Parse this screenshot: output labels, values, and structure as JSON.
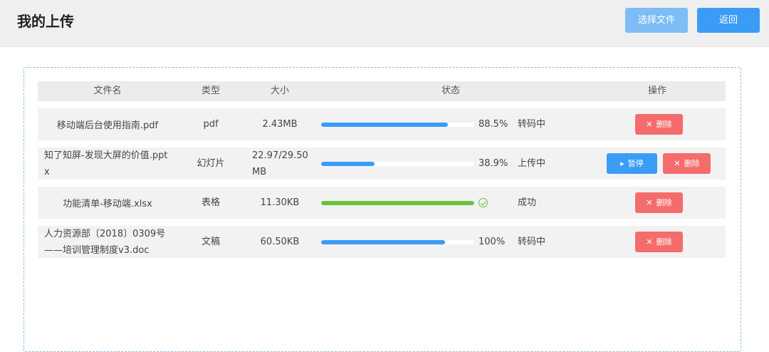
{
  "header": {
    "title": "我的上传",
    "select_label": "选择文件",
    "back_label": "返回"
  },
  "table": {
    "columns": [
      "文件名",
      "类型",
      "大小",
      "状态",
      "操作"
    ],
    "rows": [
      {
        "name": "移动端后台使用指南.pdf",
        "type": "pdf",
        "size": "2.43MB",
        "progress": 0.83,
        "progress_text": "88.5%",
        "status": "转码中",
        "actions": [
          "删除"
        ]
      },
      {
        "name_line1": "知了知屏-发现大屏的价值.ppt",
        "name_line2": "x",
        "type": "幻灯片",
        "size_line1": "22.97/29.50",
        "size_line2": "MB",
        "progress": 0.35,
        "progress_text": "38.9%",
        "status": "上传中",
        "actions": [
          "暂停",
          "删除"
        ]
      },
      {
        "name": "功能清单-移动端.xlsx",
        "type": "表格",
        "size": "11.30KB",
        "progress": 1.0,
        "progress_text": "",
        "status": "成功",
        "actions": [
          "删除"
        ]
      },
      {
        "name_line1": "人力资源部〔2018〕0309号",
        "name_line2": "——培训管理制度v3.doc",
        "type": "文稿",
        "size": "60.50KB",
        "progress": 0.81,
        "progress_text": "100%",
        "status": "转码中",
        "actions": [
          "删除"
        ]
      }
    ]
  },
  "icons": {
    "delete": "close-icon",
    "pause": "play-icon",
    "success": "check-circle-icon"
  },
  "colors": {
    "primary": "#3b9cf6",
    "danger": "#f56c6c",
    "success": "#67c23a"
  }
}
